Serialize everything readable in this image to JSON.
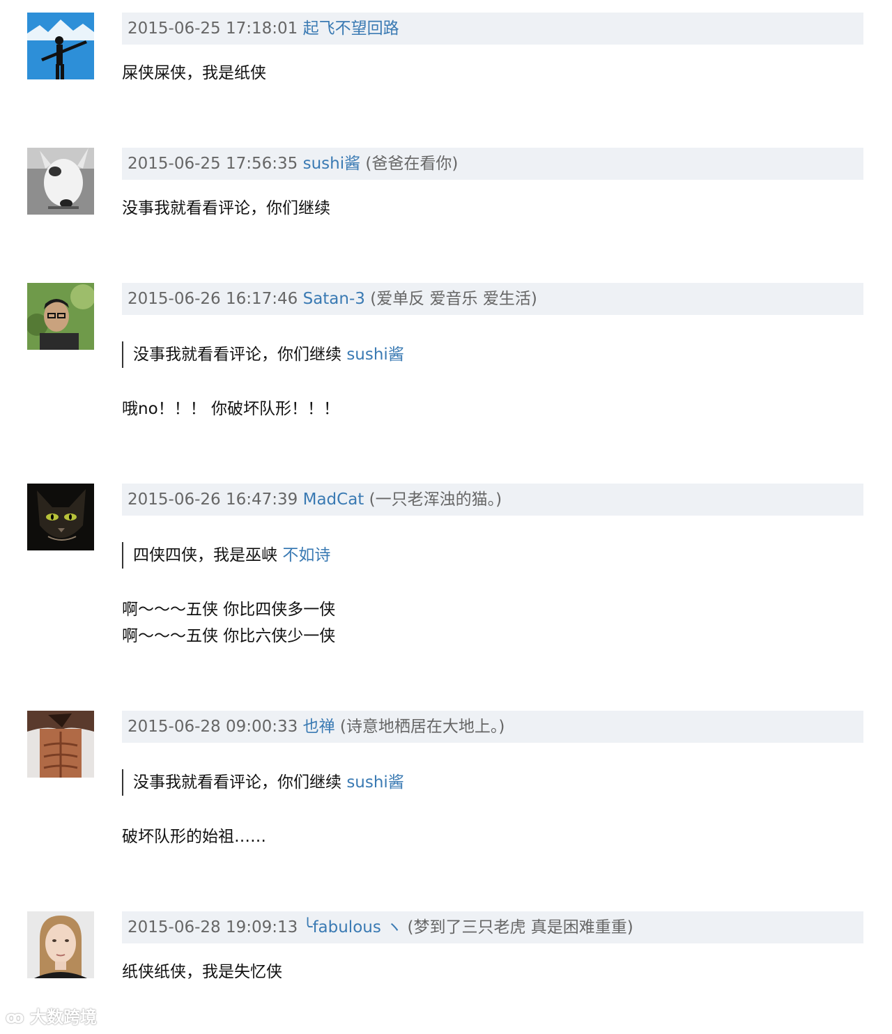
{
  "comments": [
    {
      "timestamp": "2015-06-25 17:18:01",
      "username": "起飞不望回路",
      "signature": "",
      "lines": [
        "屎侠屎侠，我是纸侠"
      ]
    },
    {
      "timestamp": "2015-06-25 17:56:35",
      "username": "sushi酱",
      "signature": "(爸爸在看你)",
      "lines": [
        "没事我就看看评论，你们继续"
      ]
    },
    {
      "timestamp": "2015-06-26 16:17:46",
      "username": "Satan-3",
      "signature": "(爱单反 爱音乐 爱生活)",
      "quote": {
        "text": "没事我就看看评论，你们继续",
        "author": "sushi酱"
      },
      "lines": [
        "哦no！！！ 你破坏队形！！！"
      ]
    },
    {
      "timestamp": "2015-06-26 16:47:39",
      "username": "MadCat",
      "signature": "(一只老浑浊的猫。)",
      "quote": {
        "text": "四侠四侠，我是巫峡",
        "author": "不如诗"
      },
      "lines": [
        "啊～～～五侠 你比四侠多一侠",
        "啊～～～五侠 你比六侠少一侠"
      ]
    },
    {
      "timestamp": "2015-06-28 09:00:33",
      "username": "也禅",
      "signature": "(诗意地栖居在大地上。)",
      "quote": {
        "text": "没事我就看看评论，你们继续",
        "author": "sushi酱"
      },
      "lines": [
        "破坏队形的始祖……"
      ]
    },
    {
      "timestamp": "2015-06-28 19:09:13",
      "username": "╰fabulous ヽ",
      "signature": "(梦到了三只老虎 真是困难重重)",
      "lines": [
        "纸侠纸侠，我是失忆侠"
      ]
    }
  ],
  "watermark": "大数跨境",
  "colors": {
    "meta_bg": "#eef1f5",
    "link": "#3a7ab3",
    "meta_text": "#666666"
  }
}
